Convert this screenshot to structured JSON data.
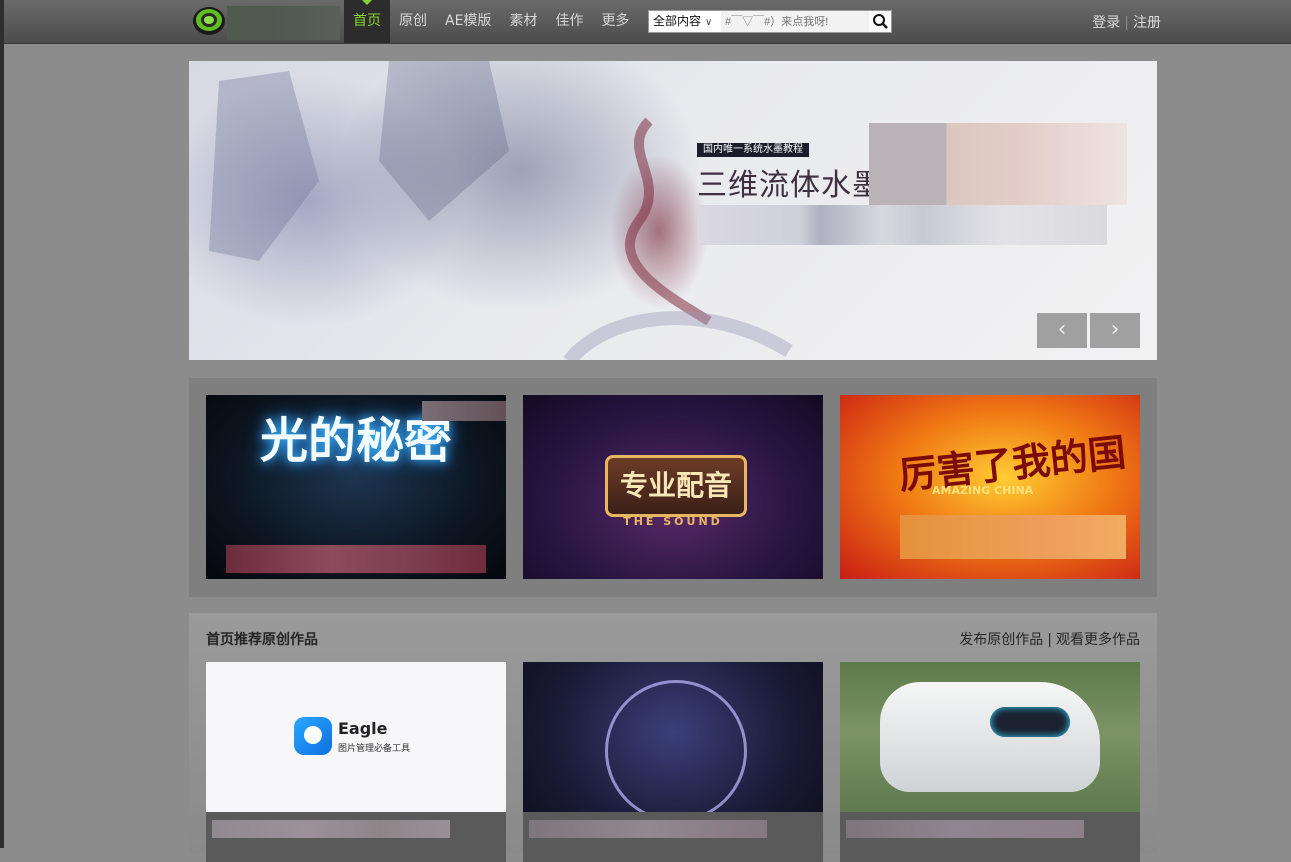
{
  "nav": {
    "items": [
      {
        "label": "首页",
        "active": true
      },
      {
        "label": "原创",
        "active": false
      },
      {
        "label": "AE模版",
        "active": false
      },
      {
        "label": "素材",
        "active": false
      },
      {
        "label": "佳作",
        "active": false
      },
      {
        "label": "更多",
        "active": false
      }
    ],
    "accent_color": "#86d32f"
  },
  "search": {
    "scope": "全部内容",
    "placeholder": "#￣▽￣#）来点我呀!"
  },
  "auth": {
    "login": "登录",
    "separator": "|",
    "register": "注册"
  },
  "banner": {
    "tag": "国内唯一系统水墨教程",
    "title": "三维流体水墨",
    "prev_icon": "chevron-left-icon",
    "next_icon": "chevron-right-icon"
  },
  "featured": [
    {
      "title": "光的秘密"
    },
    {
      "title": "专业配音",
      "subtitle": "THE SOUND"
    },
    {
      "title": "厉害了我的国",
      "subtitle": "AMAZING CHINA"
    }
  ],
  "recommended": {
    "title": "首页推荐原创作品",
    "publish_link": "发布原创作品",
    "separator": "|",
    "more_link": "观看更多作品",
    "cards": [
      {
        "brand": "Eagle",
        "brand_subtitle": "图片管理必备工具"
      },
      {},
      {}
    ]
  }
}
